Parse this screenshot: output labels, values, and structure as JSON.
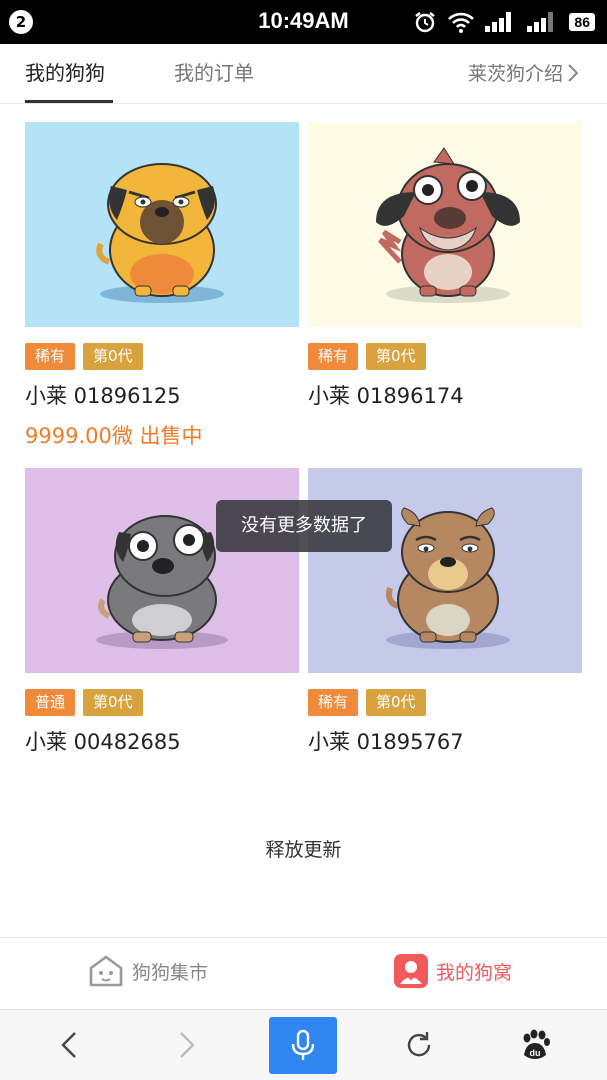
{
  "status_bar": {
    "notification_count": "2",
    "time": "10:49AM",
    "battery": "86"
  },
  "tabs": [
    {
      "label": "我的狗狗",
      "active": true
    },
    {
      "label": "我的订单",
      "active": false
    }
  ],
  "intro_link": "莱茨狗介绍",
  "dogs": [
    {
      "rarity": "稀有",
      "generation": "第0代",
      "name": "小莱 01896125",
      "price": "9999.00微 出售中",
      "bg": "#b4e3f8"
    },
    {
      "rarity": "稀有",
      "generation": "第0代",
      "name": "小莱 01896174",
      "bg": "#fdfae6"
    },
    {
      "rarity": "普通",
      "generation": "第0代",
      "name": "小莱 00482685",
      "bg": "#dfbfe9"
    },
    {
      "rarity": "稀有",
      "generation": "第0代",
      "name": "小莱 01895767",
      "bg": "#c5c9ea"
    }
  ],
  "toast": "没有更多数据了",
  "pull_status": "释放更新",
  "bottom_nav": {
    "market": "狗狗集市",
    "my_den": "我的狗窝"
  },
  "colors": {
    "accent_orange": "#f08a3b",
    "gold": "#d8a33e",
    "price": "#f07c2a",
    "nav_active": "#f15a5a",
    "mic_blue": "#2f86f0"
  },
  "browser_toolbar": [
    "back-icon",
    "forward-icon",
    "voice-search-icon",
    "refresh-icon",
    "baidu-paw-icon"
  ]
}
